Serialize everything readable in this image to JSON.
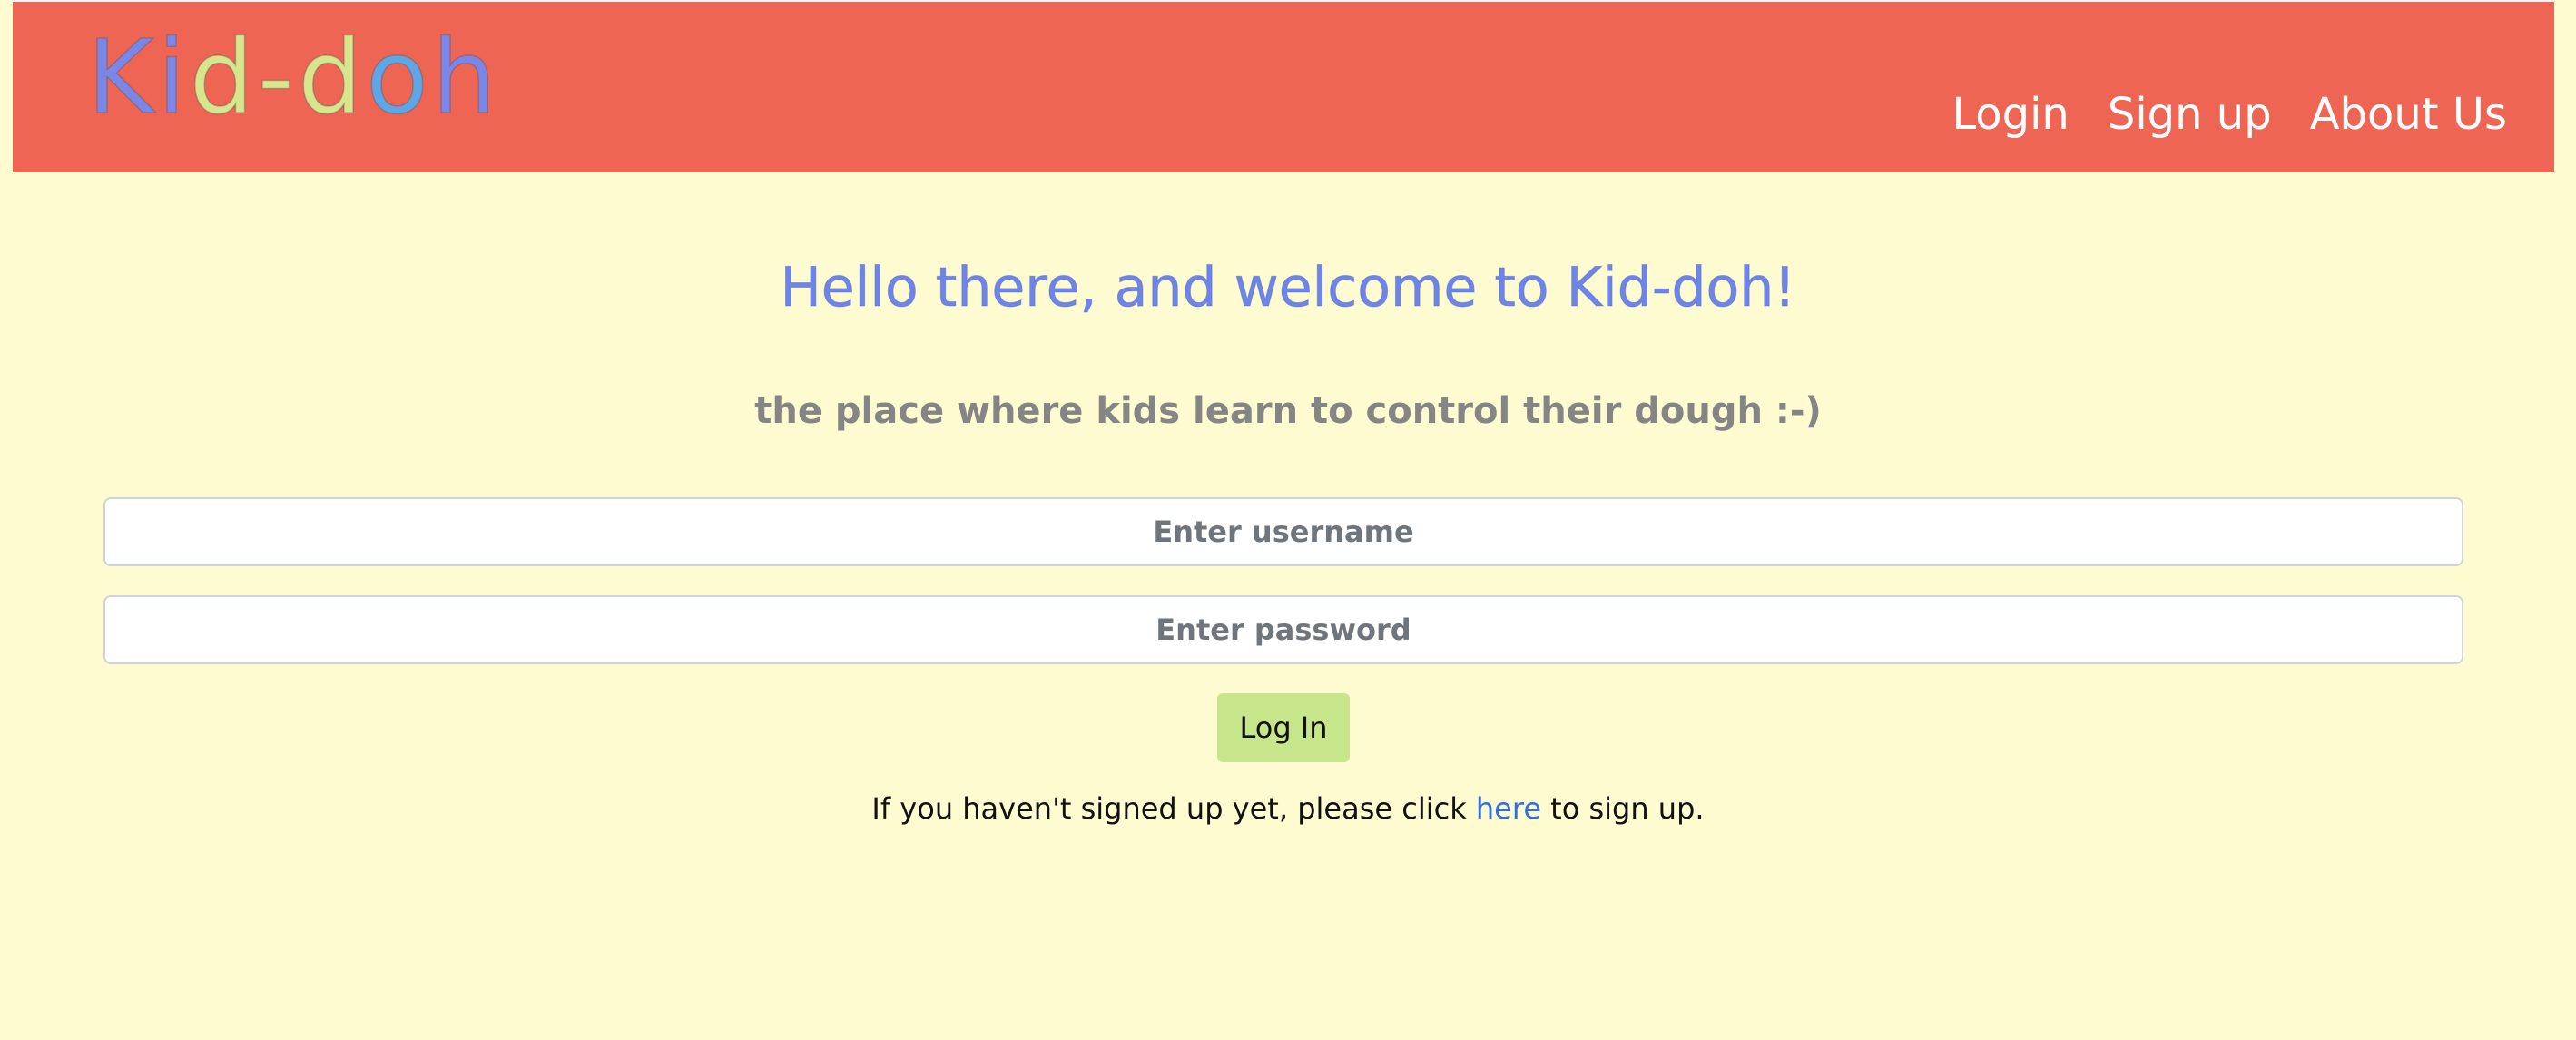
{
  "header": {
    "logo_letters": [
      {
        "char": "K",
        "color": "#7C86E6"
      },
      {
        "char": "i",
        "color": "#7C86E6"
      },
      {
        "char": "d",
        "color": "#D7E58C"
      },
      {
        "char": "-",
        "color": "#D7E58C"
      },
      {
        "char": "d",
        "color": "#D7E58C"
      },
      {
        "char": "o",
        "color": "#5FA6E6"
      },
      {
        "char": "h",
        "color": "#7C86E6"
      }
    ],
    "nav": {
      "login": "Login",
      "signup": "Sign up",
      "about": "About Us"
    },
    "background_color": "#EE6553"
  },
  "main": {
    "welcome": "Hello there, and welcome to Kid-doh!",
    "tagline": "the place where kids learn to control their dough :-)",
    "username_placeholder": "Enter username",
    "password_placeholder": "Enter password",
    "login_button": "Log In",
    "signup_prefix": "If you haven't signed up yet, please click ",
    "signup_link": "here",
    "signup_suffix": " to sign up.",
    "background_color": "#FFFBD0",
    "button_color": "#C7E58A",
    "link_color": "#2F6FE0"
  }
}
